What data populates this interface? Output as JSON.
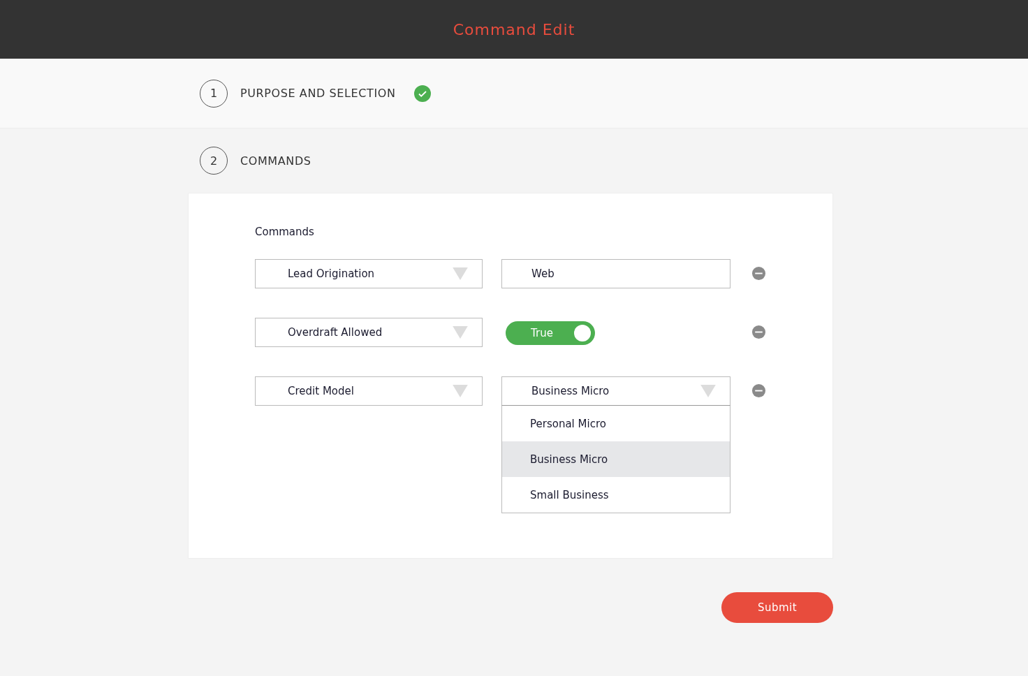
{
  "header": {
    "title": "Command Edit"
  },
  "steps": [
    {
      "number": "1",
      "label": "PURPOSE AND SELECTION",
      "completed": true
    },
    {
      "number": "2",
      "label": "COMMANDS",
      "completed": false
    }
  ],
  "commands": {
    "title": "Commands",
    "rows": [
      {
        "kind": "text",
        "key": "Lead Origination",
        "value": "Web"
      },
      {
        "kind": "toggle",
        "key": "Overdraft Allowed",
        "value": "True",
        "on": true
      },
      {
        "kind": "select",
        "key": "Credit Model",
        "value": "Business Micro",
        "expanded": true,
        "options": [
          {
            "label": "Personal Micro",
            "selected": false
          },
          {
            "label": "Business Micro",
            "selected": true
          },
          {
            "label": "Small Business",
            "selected": false
          }
        ]
      }
    ]
  },
  "submit": "Submit"
}
